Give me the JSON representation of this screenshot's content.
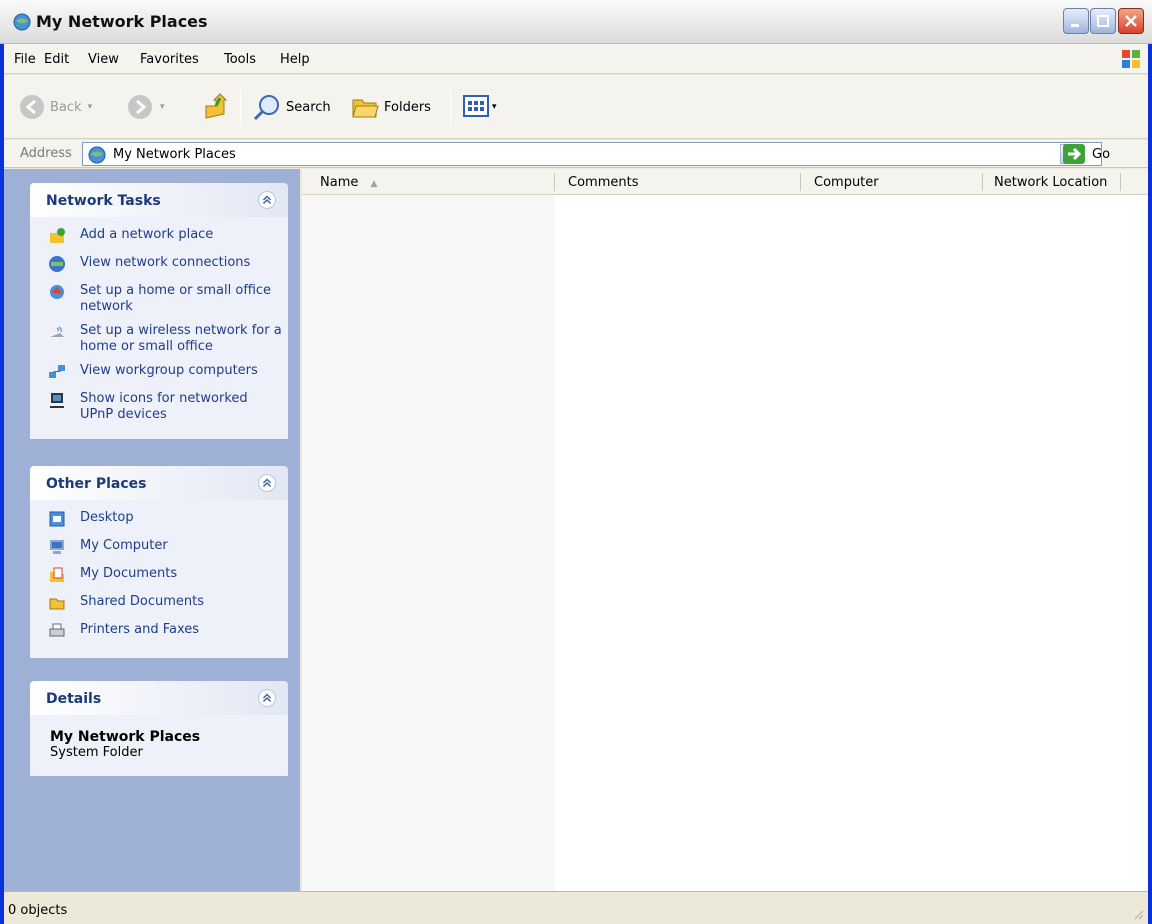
{
  "window": {
    "title": "My Network Places"
  },
  "menu": [
    "File",
    "Edit",
    "View",
    "Favorites",
    "Tools",
    "Help"
  ],
  "toolbar": {
    "back_label": "Back",
    "search_label": "Search",
    "folders_label": "Folders"
  },
  "address": {
    "label": "Address",
    "value": "My Network Places",
    "go_label": "Go"
  },
  "left": {
    "network_tasks": {
      "title": "Network Tasks",
      "items": [
        "Add a network place",
        "View network connections",
        "Set up a home or small office network",
        "Set up a wireless network for a home or small office",
        "View workgroup computers",
        "Show icons for networked UPnP devices"
      ]
    },
    "other_places": {
      "title": "Other Places",
      "items": [
        "Desktop",
        "My Computer",
        "My Documents",
        "Shared Documents",
        "Printers and Faxes"
      ]
    },
    "details": {
      "title": "Details",
      "name": "My Network Places",
      "type": "System Folder"
    }
  },
  "columns": [
    "Name",
    "Comments",
    "Computer",
    "Network Location"
  ],
  "status": {
    "text": "0 objects"
  },
  "colors": {
    "pane": "#9fb0d6",
    "link": "#1f3d8a",
    "chrome": "#ece9d8"
  }
}
